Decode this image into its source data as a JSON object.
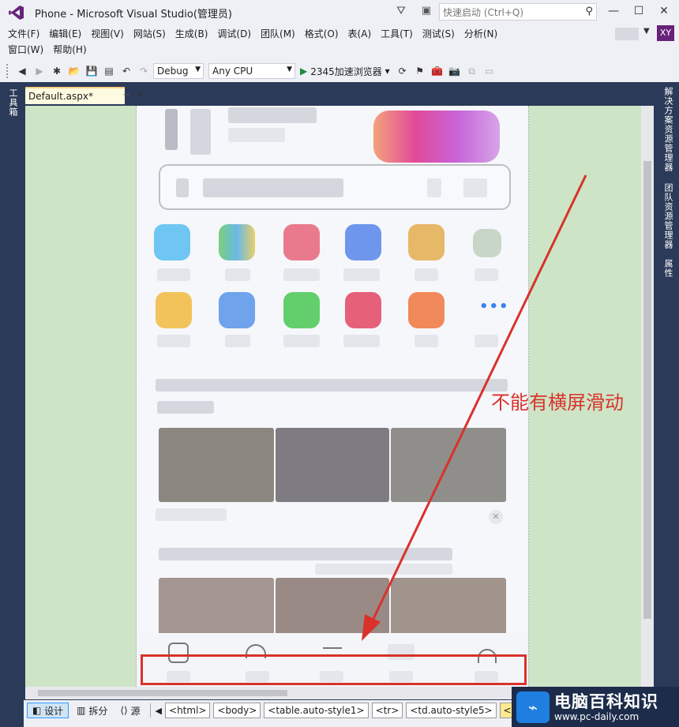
{
  "window": {
    "title": "Phone - Microsoft Visual Studio(管理员)",
    "quick_launch_placeholder": "快速启动 (Ctrl+Q)",
    "user_initials": "XY"
  },
  "menu": {
    "row1": [
      "文件(F)",
      "编辑(E)",
      "视图(V)",
      "网站(S)",
      "生成(B)",
      "调试(D)",
      "团队(M)",
      "格式(O)",
      "表(A)",
      "工具(T)",
      "测试(S)",
      "分析(N)"
    ],
    "row2": [
      "窗口(W)",
      "帮助(H)"
    ]
  },
  "toolbar": {
    "config": "Debug",
    "platform": "Any CPU",
    "run_label": "2345加速浏览器"
  },
  "left_panel": {
    "toolbox": "工具箱"
  },
  "right_panel": {
    "solution_explorer": "解决方案资源管理器",
    "team_explorer": "团队资源管理器",
    "properties": "属性"
  },
  "doc_tab": {
    "label": "Default.aspx*"
  },
  "annotation": {
    "text": "不能有横屏滑动"
  },
  "statusbar": {
    "views": [
      "设计",
      "拆分",
      "源"
    ],
    "breadcrumbs": [
      "<html>",
      "<body>",
      "<table.auto-style1>",
      "<tr>",
      "<td.auto-style5>",
      "<img"
    ]
  },
  "watermark": {
    "title": "电脑百科知识",
    "url": "www.pc-daily.com"
  },
  "colors": {
    "editor_bg": "#cde5c6",
    "side_panel": "#2b3a58",
    "annotation_red": "#d9322b",
    "vs_purple": "#68217a"
  }
}
